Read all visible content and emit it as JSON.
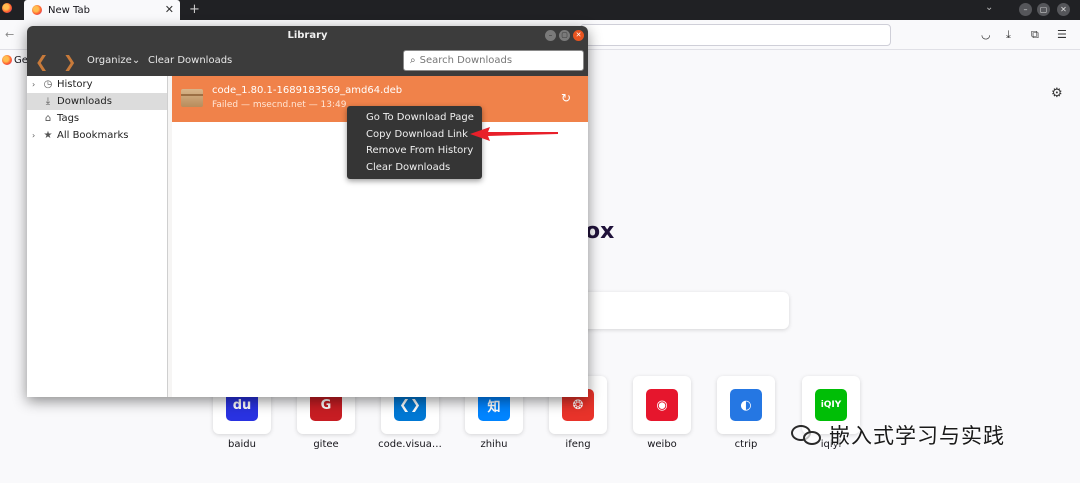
{
  "browser": {
    "tab_title": "New Tab",
    "bookmark_partial": "Ge"
  },
  "library": {
    "window_title": "Library",
    "toolbar": {
      "organize_label": "Organize",
      "clear_label": "Clear Downloads"
    },
    "search": {
      "placeholder": "Search Downloads"
    },
    "sidebar": {
      "items": [
        {
          "label": "History",
          "icon": "clock-icon",
          "expandable": true,
          "selected": false
        },
        {
          "label": "Downloads",
          "icon": "download-icon",
          "expandable": false,
          "selected": true
        },
        {
          "label": "Tags",
          "icon": "tag-icon",
          "expandable": false,
          "selected": false
        },
        {
          "label": "All Bookmarks",
          "icon": "star-icon",
          "expandable": true,
          "selected": false
        }
      ]
    },
    "download": {
      "filename": "code_1.80.1-1689183569_amd64.deb",
      "status": "Failed — msecnd.net — 13:49"
    }
  },
  "context_menu": {
    "items": [
      {
        "label": "Go To Download Page"
      },
      {
        "label": "Copy Download Link"
      },
      {
        "label": "Remove From History"
      },
      {
        "label": "Clear Downloads"
      }
    ]
  },
  "newtab": {
    "brand_fragment": "ox",
    "shortcuts": [
      {
        "label": "baidu",
        "color": "#2932e1",
        "glyph": "du"
      },
      {
        "label": "gitee",
        "color": "#c71d23",
        "glyph": "G"
      },
      {
        "label": "code.visua…",
        "color": "#0078d4",
        "glyph": "❮❯"
      },
      {
        "label": "zhihu",
        "color": "#0084ff",
        "glyph": "知"
      },
      {
        "label": "ifeng",
        "color": "#e8332a",
        "glyph": "❂"
      },
      {
        "label": "weibo",
        "color": "#e6162d",
        "glyph": "◉"
      },
      {
        "label": "ctrip",
        "color": "#2577e3",
        "glyph": "◐"
      },
      {
        "label": "iqiyi",
        "color": "#00be06",
        "glyph": "iQIY"
      }
    ]
  },
  "watermark": {
    "text": "嵌入式学习与实践"
  }
}
